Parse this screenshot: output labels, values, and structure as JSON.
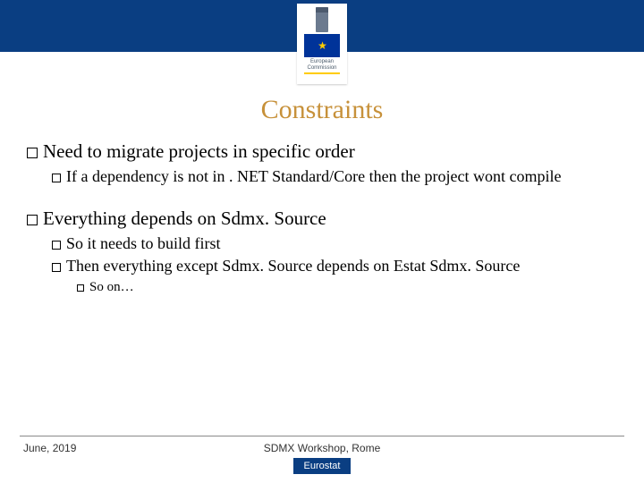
{
  "header": {
    "org_line1": "European",
    "org_line2": "Commission"
  },
  "title": "Constraints",
  "bullets": [
    {
      "level": 1,
      "text": "Need to migrate projects in specific order",
      "children": [
        {
          "level": 2,
          "text": "If a dependency is not in . NET Standard/Core then the project wont compile"
        }
      ]
    },
    {
      "level": 1,
      "text": "Everything depends on Sdmx. Source",
      "children": [
        {
          "level": 2,
          "text": "So it needs to build first"
        },
        {
          "level": 2,
          "text": "Then everything except Sdmx. Source depends on Estat Sdmx. Source",
          "children": [
            {
              "level": 3,
              "text": "So on…"
            }
          ]
        }
      ]
    }
  ],
  "footer": {
    "left": "June, 2019",
    "center": "SDMX Workshop, Rome",
    "badge": "Eurostat"
  }
}
